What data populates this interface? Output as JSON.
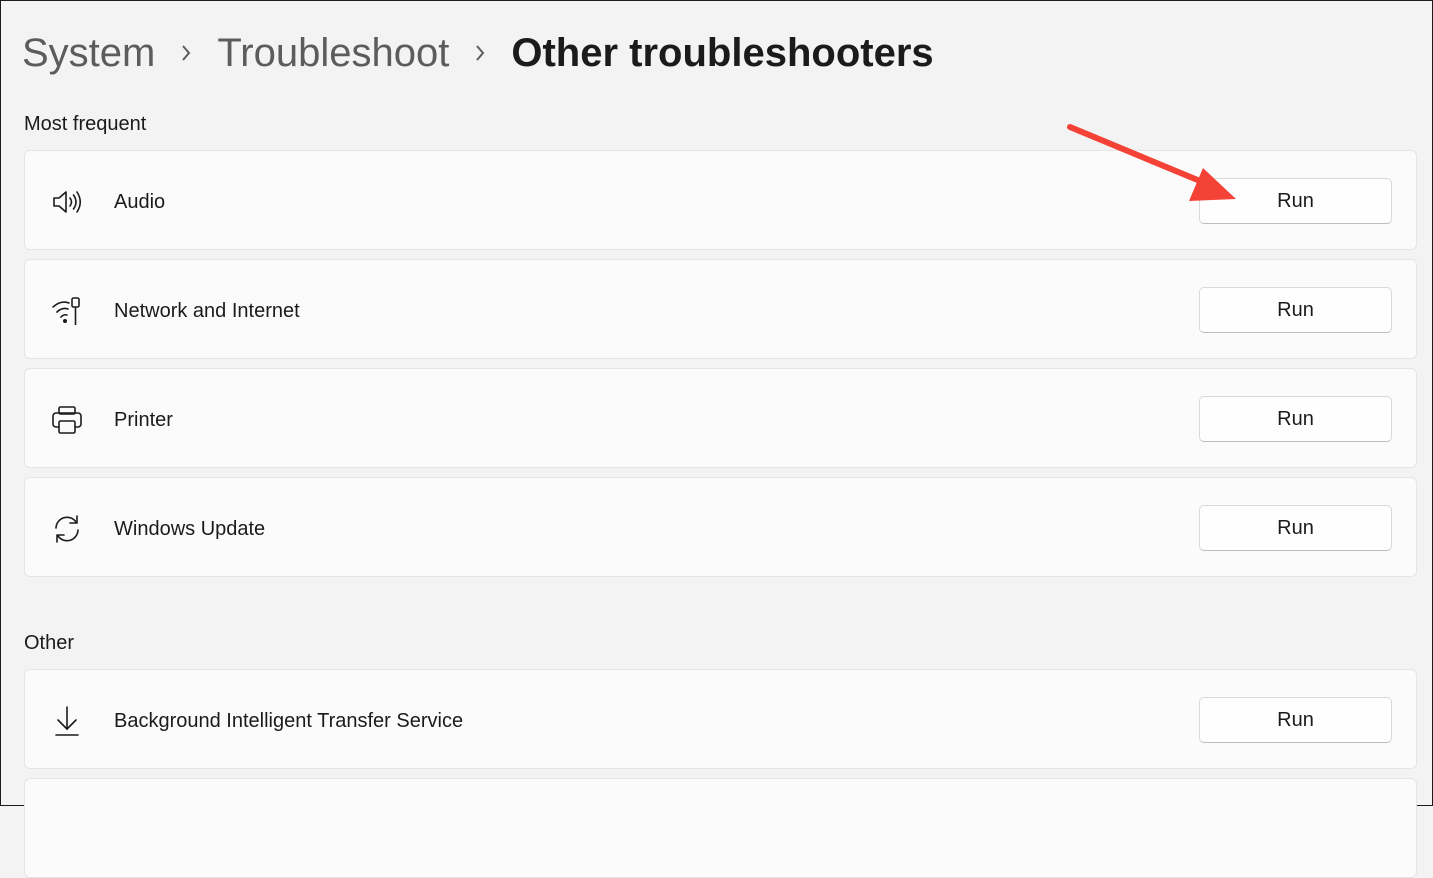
{
  "breadcrumb": {
    "items": [
      "System",
      "Troubleshoot",
      "Other troubleshooters"
    ]
  },
  "sections": {
    "most_frequent": {
      "title": "Most frequent",
      "items": [
        {
          "label": "Audio",
          "icon": "speaker-icon",
          "button": "Run"
        },
        {
          "label": "Network and Internet",
          "icon": "wifi-icon",
          "button": "Run"
        },
        {
          "label": "Printer",
          "icon": "printer-icon",
          "button": "Run"
        },
        {
          "label": "Windows Update",
          "icon": "sync-icon",
          "button": "Run"
        }
      ]
    },
    "other": {
      "title": "Other",
      "items": [
        {
          "label": "Background Intelligent Transfer Service",
          "icon": "download-icon",
          "button": "Run"
        }
      ]
    }
  },
  "annotation": {
    "type": "red-arrow",
    "color": "#f44336",
    "target": "audio-run-button"
  },
  "colors": {
    "background": "#f3f3f3",
    "card": "#fbfbfb",
    "card_border": "#e5e5e5",
    "text": "#1b1b1b",
    "muted": "#5c5c5c"
  }
}
